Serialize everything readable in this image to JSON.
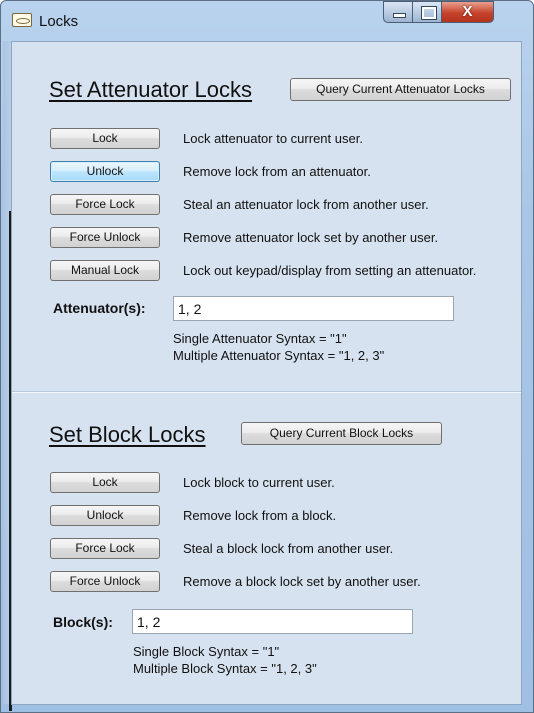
{
  "window": {
    "title": "Locks",
    "icon": "app-icon",
    "close_glyph": "X"
  },
  "attenuator": {
    "title": "Set Attenuator Locks",
    "query_button": "Query Current Attenuator Locks",
    "actions": [
      {
        "label": "Lock",
        "description": "Lock attenuator to current user."
      },
      {
        "label": "Unlock",
        "description": "Remove lock from an attenuator."
      },
      {
        "label": "Force Lock",
        "description": "Steal an attenuator lock from another user."
      },
      {
        "label": "Force Unlock",
        "description": "Remove attenuator lock set by another user."
      },
      {
        "label": "Manual Lock",
        "description": "Lock out keypad/display from setting an attenuator."
      }
    ],
    "field_label": "Attenuator(s):",
    "field_value": "1, 2",
    "hint_single": "Single Attenuator Syntax = \"1\"",
    "hint_multiple": "Multiple Attenuator Syntax = \"1, 2, 3\""
  },
  "block": {
    "title": "Set Block Locks",
    "query_button": "Query Current Block Locks",
    "actions": [
      {
        "label": "Lock",
        "description": "Lock block to current user."
      },
      {
        "label": "Unlock",
        "description": "Remove lock from a block."
      },
      {
        "label": "Force Lock",
        "description": "Steal a block lock from another user."
      },
      {
        "label": "Force Unlock",
        "description": "Remove a block lock set by another user."
      }
    ],
    "field_label": "Block(s):",
    "field_value": "1, 2",
    "hint_single": "Single Block Syntax = \"1\"",
    "hint_multiple": "Multiple Block Syntax = \"1, 2, 3\""
  }
}
